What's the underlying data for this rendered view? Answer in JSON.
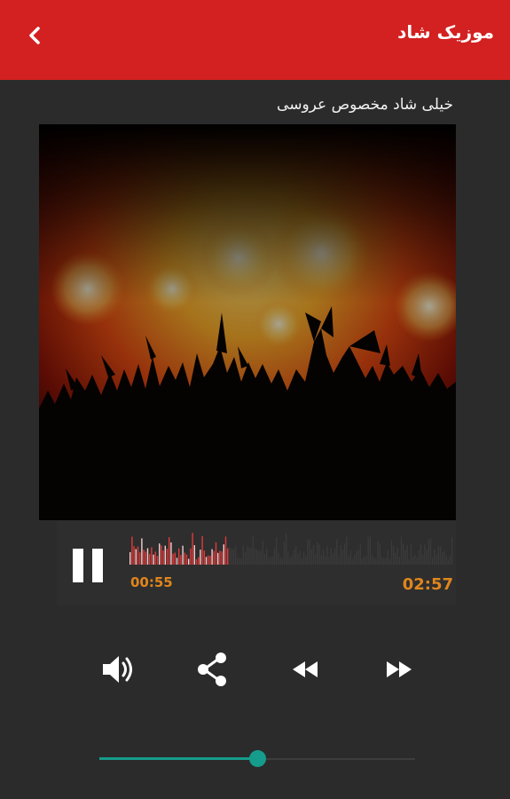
{
  "appbar": {
    "title": "موزیک شاد",
    "color": "#d32020"
  },
  "track": {
    "title": "خیلی شاد مخصوص عروسی",
    "current_time": "00:55",
    "total_time": "02:57",
    "played_fraction": 0.31
  },
  "controls": {
    "icons": [
      "volume-icon",
      "share-icon",
      "rewind-icon",
      "fast-forward-icon",
      "pause-icon",
      "back-icon"
    ]
  },
  "seekbar": {
    "value_fraction": 0.5,
    "accent": "#169c8c"
  },
  "colors": {
    "time_text": "#e0861c",
    "background": "#2b2b2b"
  }
}
